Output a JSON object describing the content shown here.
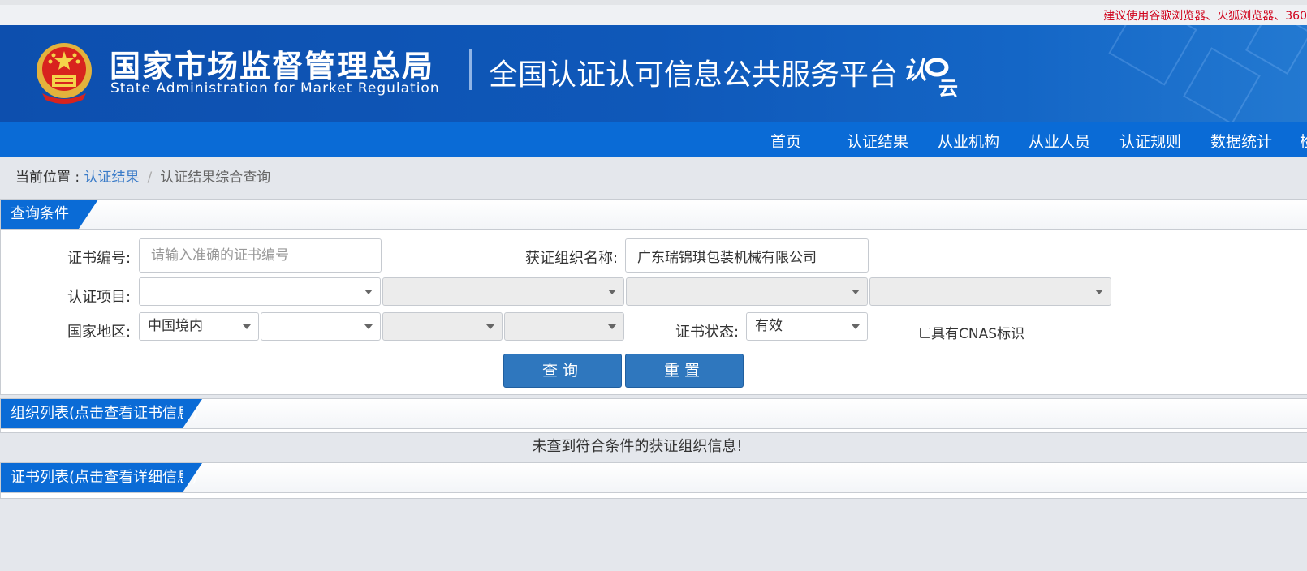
{
  "top_notice": "建议使用谷歌浏览器、火狐浏览器、360",
  "header": {
    "agency_cn": "国家市场监督管理总局",
    "agency_en": "State Administration  for  Market Regulation",
    "platform_title": "全国认证认可信息公共服务平台",
    "logo_text": "认云"
  },
  "nav": [
    "首页",
    "认证结果",
    "从业机构",
    "从业人员",
    "认证规则",
    "数据统计",
    "检"
  ],
  "breadcrumb": {
    "prefix": "当前位置 : ",
    "link": "认证结果",
    "separator": "/",
    "current": "认证结果综合查询"
  },
  "query": {
    "tab": "查询条件",
    "cert_no_label": "证书编号:",
    "cert_no_placeholder": "请输入准确的证书编号",
    "cert_no_value": "",
    "org_name_label": "获证组织名称:",
    "org_name_value": "广东瑞锦琪包装机械有限公司",
    "project_label": "认证项目:",
    "region_label": "国家地区:",
    "region_value": "中国境内",
    "status_label": "证书状态:",
    "status_value": "有效",
    "cnas_label": "具有CNAS标识",
    "search_button": "查询",
    "reset_button": "重置"
  },
  "org_list": {
    "tab": "组织列表(点击查看证书信息)",
    "empty_message": "未查到符合条件的获证组织信息!"
  },
  "cert_list": {
    "tab": "证书列表(点击查看详细信息)"
  }
}
